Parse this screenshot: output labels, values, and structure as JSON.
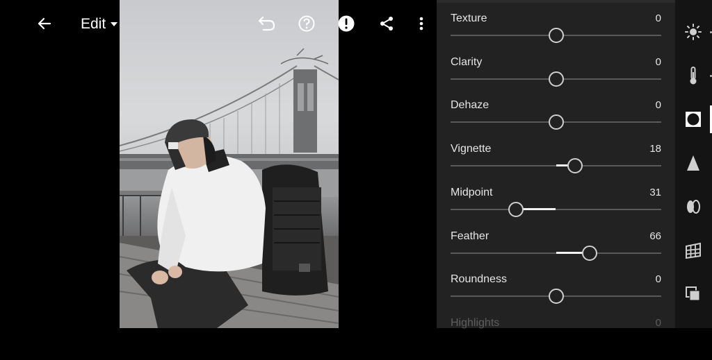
{
  "toolbar": {
    "edit_label": "Edit",
    "icons": [
      "back-arrow-icon",
      "caret-down-icon",
      "undo-icon",
      "help-icon",
      "alert-icon",
      "share-icon",
      "more-vertical-icon"
    ]
  },
  "sliders": [
    {
      "label": "Texture",
      "value": "0",
      "level": 0.5
    },
    {
      "label": "Clarity",
      "value": "0",
      "level": 0.5
    },
    {
      "label": "Dehaze",
      "value": "0",
      "level": 0.5
    },
    {
      "label": "Vignette",
      "value": "18",
      "level": 0.59
    },
    {
      "label": "Midpoint",
      "value": "31",
      "level": 0.31
    },
    {
      "label": "Feather",
      "value": "66",
      "level": 0.66
    },
    {
      "label": "Roundness",
      "value": "0",
      "level": 0.5
    },
    {
      "label": "Highlights",
      "value": "0",
      "level": 0.5
    }
  ],
  "sidebar": {
    "icons": [
      "light-sun-icon",
      "color-thermometer-icon",
      "effects-vignette-icon",
      "detail-triangle-icon",
      "optics-lens-icon",
      "geometry-grid-icon",
      "presets-layers-icon"
    ],
    "active": "effects-vignette-icon"
  },
  "colors": {
    "panel_bg": "#222222",
    "sidebar_bg": "#141414",
    "accent": "#ffffff"
  }
}
